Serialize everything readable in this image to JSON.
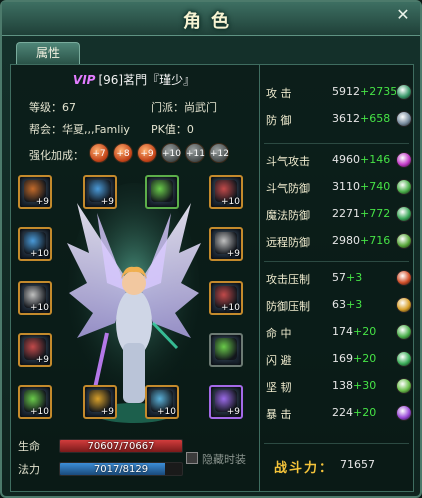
{
  "window": {
    "title": "角色",
    "close_label": "✕"
  },
  "tabs": [
    {
      "label": "属性"
    }
  ],
  "character": {
    "vip": "VIP",
    "name": "[96]茗門『瑾少』",
    "level_label": "等级：67",
    "sect_label": "门派：尚武门",
    "guild_label": "帮会：华夏,,,Famliy",
    "pk_label": "PK值：0",
    "enhance_label": "强化加成："
  },
  "enhance_orbs": [
    "+7",
    "+8",
    "+9",
    "+10",
    "+11",
    "+12"
  ],
  "enhance_orbs_lit": [
    true,
    true,
    true,
    false,
    false,
    false
  ],
  "equipment": {
    "left": [
      "+9",
      "+10",
      "+10",
      "+9",
      "+10"
    ],
    "left_colors": [
      "#c48a2c",
      "#c48a2c",
      "#c48a2c",
      "#c48a2c",
      "#c48a2c"
    ],
    "top": [
      "+9",
      "",
      "+10"
    ],
    "right": [
      "+9",
      "+10",
      "",
      "+9"
    ],
    "bottom": [
      "+9",
      "+10"
    ]
  },
  "hp": {
    "label": "生命",
    "text": "70607/70667",
    "current": 70607,
    "max": 70667,
    "color": "#d23c3c"
  },
  "mp": {
    "label": "法力",
    "text": "7017/8129",
    "current": 7017,
    "max": 8129,
    "color": "#3c8ed8"
  },
  "hide_fashion": {
    "label": "隐藏时装",
    "checked": false
  },
  "stats_group1": [
    {
      "label": "攻    击",
      "value": "5912",
      "bonus": "+2735",
      "icon_color": "#3c9a6c"
    },
    {
      "label": "防    御",
      "value": "3612",
      "bonus": "+658",
      "icon_color": "#7a8ea0"
    }
  ],
  "stats_group2": [
    {
      "label": "斗气攻击",
      "value": "4960",
      "bonus": "+146",
      "icon_color": "#c23ac8"
    },
    {
      "label": "斗气防御",
      "value": "3110",
      "bonus": "+740",
      "icon_color": "#4ab04a"
    },
    {
      "label": "魔法防御",
      "value": "2271",
      "bonus": "+772",
      "icon_color": "#3ca85a"
    },
    {
      "label": "远程防御",
      "value": "2980",
      "bonus": "+716",
      "icon_color": "#5aa83c"
    }
  ],
  "stats_group3": [
    {
      "label": "攻击压制",
      "value": "57",
      "bonus": "+3",
      "icon_color": "#d2502a"
    },
    {
      "label": "防御压制",
      "value": "63",
      "bonus": "+3",
      "icon_color": "#d8a02a"
    },
    {
      "label": "命    中",
      "value": "174",
      "bonus": "+20",
      "icon_color": "#4cb04c"
    },
    {
      "label": "闪    避",
      "value": "169",
      "bonus": "+20",
      "icon_color": "#3cae5a"
    },
    {
      "label": "坚    韧",
      "value": "138",
      "bonus": "+30",
      "icon_color": "#6abf4a"
    },
    {
      "label": "暴    击",
      "value": "224",
      "bonus": "+20",
      "icon_color": "#9a4ad8"
    }
  ],
  "power": {
    "label": "战斗力：",
    "value": "71657"
  }
}
